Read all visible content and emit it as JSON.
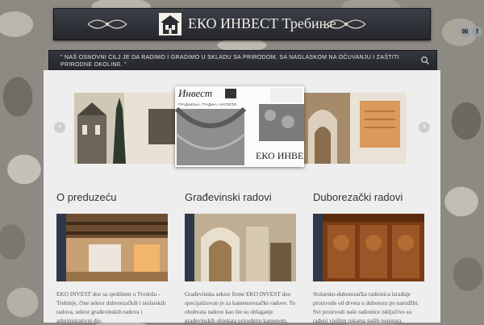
{
  "header": {
    "title": "ЕКО ИНВЕСТ Требиње",
    "social": [
      {
        "icon": "mail-icon",
        "glyph": "✉"
      },
      {
        "icon": "facebook-icon",
        "glyph": "f"
      }
    ]
  },
  "tagline": {
    "text": "\" NAŠ OSNOVNI CILJ JE DA RADIMO I GRADIMO U SKLADU SA PRIRODOM, SA NAGLASKOM NA OČUVANJU I ZAŠTITI PRIRODNE OKOLINE. \""
  },
  "slider": {
    "arrow_prev": "‹",
    "arrow_next": "›",
    "main_slide": {
      "brand_top": "Инвест",
      "subtitle": "ГРАДЊЕЊА, ГРАДЊА, НАСЛЕЂЕ",
      "brand_bottom": "ЕКО ИНВЕ"
    }
  },
  "columns": [
    {
      "title": "O preduzeću",
      "text": "EKO INVEST doo sa sjedištem u Tvrdošu -Trebinje, čine sektor duborezačkih i stolarskih radova, sektor građevinskih radova i administrativni dio."
    },
    {
      "title": "Građevinski radovi",
      "text": "Građevinska sektor firme EKO INVEST doo specijalizovan je za kamenorezačke radove. To obuhvata radove kao što su oblaganje građevinskih objekata prirodnim kamenom."
    },
    {
      "title": "Duborezački radovi",
      "text": "Stolarsko-duborezačka radionica izrađuje proizvode od drveta u duborezu po narudžbi. Svi proizvodi naše radionice isključivo su rađeni vještim rukama naših majstora."
    }
  ]
}
